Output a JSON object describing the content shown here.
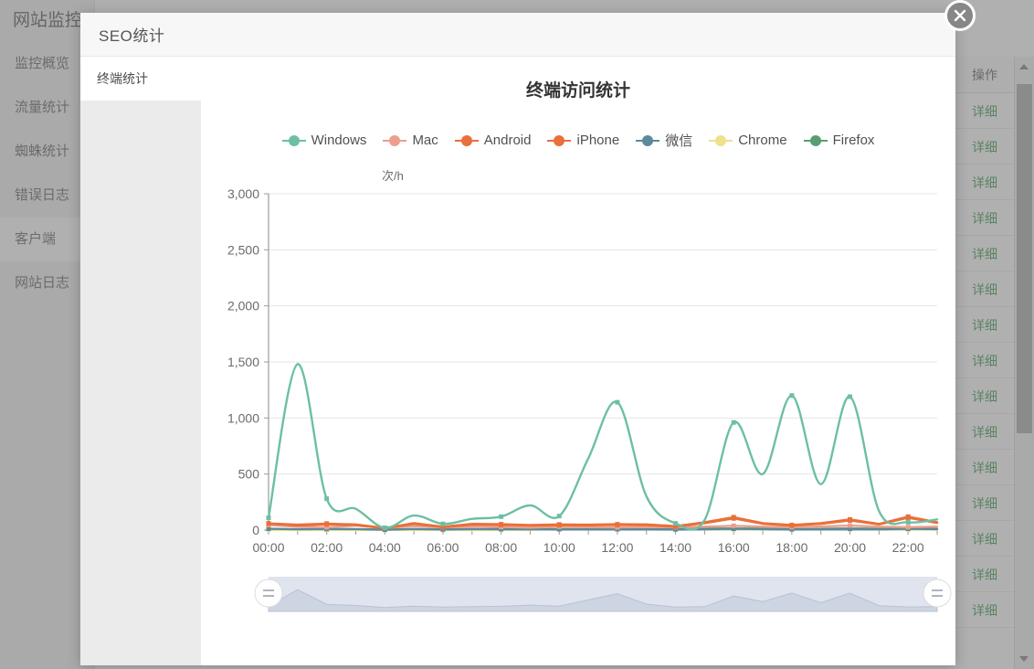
{
  "background": {
    "brand": "网站监控",
    "nav_items": [
      {
        "label": "监控概览",
        "active": false
      },
      {
        "label": "流量统计",
        "active": false
      },
      {
        "label": "蜘蛛统计",
        "active": false
      },
      {
        "label": "错误日志",
        "active": false
      },
      {
        "label": "客户端",
        "active": true
      },
      {
        "label": "网站日志",
        "active": false
      }
    ],
    "table": {
      "op_column_header": "操作",
      "detail_link_label": "详细",
      "row_count": 15
    },
    "scrollbar": {
      "up_arrow": "scroll-up",
      "down_arrow": "scroll-down"
    }
  },
  "modal": {
    "title": "SEO统计",
    "close_label": "close-icon",
    "nav_items": [
      {
        "label": "终端统计",
        "active": true
      }
    ]
  },
  "chart_data": {
    "type": "line",
    "title": "终端访问统计",
    "ylabel": "次/h",
    "xlabel": "",
    "ylim": [
      0,
      3000
    ],
    "yticks": [
      "0",
      "500",
      "1,000",
      "1,500",
      "2,000",
      "2,500",
      "3,000"
    ],
    "ytick_values": [
      0,
      500,
      1000,
      1500,
      2000,
      2500,
      3000
    ],
    "grid": true,
    "legend_position": "top",
    "x": [
      "00:00",
      "01:00",
      "02:00",
      "03:00",
      "04:00",
      "05:00",
      "06:00",
      "07:00",
      "08:00",
      "09:00",
      "10:00",
      "11:00",
      "12:00",
      "13:00",
      "14:00",
      "15:00",
      "16:00",
      "17:00",
      "18:00",
      "19:00",
      "20:00",
      "21:00",
      "22:00",
      "23:00"
    ],
    "xtick_labels": [
      "00:00",
      "02:00",
      "04:00",
      "06:00",
      "08:00",
      "10:00",
      "12:00",
      "14:00",
      "16:00",
      "18:00",
      "20:00",
      "22:00"
    ],
    "series": [
      {
        "name": "Windows",
        "color": "#6dbfa4",
        "values": [
          110,
          1480,
          280,
          190,
          20,
          130,
          55,
          100,
          120,
          220,
          125,
          640,
          1140,
          300,
          60,
          90,
          960,
          500,
          1200,
          410,
          1190,
          170,
          70,
          95
        ]
      },
      {
        "name": "Mac",
        "color": "#eb9f8c",
        "values": [
          45,
          30,
          25,
          40,
          20,
          35,
          25,
          30,
          28,
          22,
          30,
          26,
          24,
          28,
          26,
          30,
          38,
          30,
          26,
          32,
          40,
          30,
          26,
          30
        ]
      },
      {
        "name": "Android",
        "color": "#e8703a",
        "values": [
          60,
          48,
          58,
          50,
          18,
          62,
          30,
          55,
          52,
          45,
          50,
          48,
          52,
          50,
          35,
          70,
          115,
          62,
          45,
          62,
          95,
          55,
          120,
          70
        ]
      },
      {
        "name": "iPhone",
        "color": "#e8703a",
        "values": [
          58,
          40,
          52,
          44,
          16,
          56,
          26,
          48,
          46,
          40,
          44,
          42,
          46,
          44,
          30,
          62,
          104,
          56,
          40,
          56,
          86,
          50,
          110,
          64
        ]
      },
      {
        "name": "微信",
        "color": "#5b8a9a",
        "values": [
          12,
          8,
          10,
          9,
          4,
          10,
          6,
          9,
          8,
          7,
          8,
          8,
          8,
          8,
          6,
          9,
          12,
          9,
          7,
          9,
          11,
          8,
          12,
          9
        ]
      },
      {
        "name": "Chrome",
        "color": "#efe08a",
        "values": [
          2,
          2,
          2,
          2,
          2,
          2,
          2,
          2,
          2,
          2,
          12,
          14,
          16,
          14,
          10,
          8,
          6,
          6,
          8,
          12,
          10,
          8,
          6,
          4
        ]
      },
      {
        "name": "Firefox",
        "color": "#5a9e6f",
        "values": [
          4,
          3,
          4,
          3,
          3,
          3,
          3,
          4,
          12,
          14,
          14,
          14,
          14,
          14,
          14,
          14,
          14,
          14,
          14,
          14,
          14,
          14,
          14,
          10
        ]
      }
    ],
    "datazoom": {
      "start_handle": "datazoom-handle-left",
      "end_handle": "datazoom-handle-right",
      "range_percent": [
        0,
        100
      ]
    }
  }
}
